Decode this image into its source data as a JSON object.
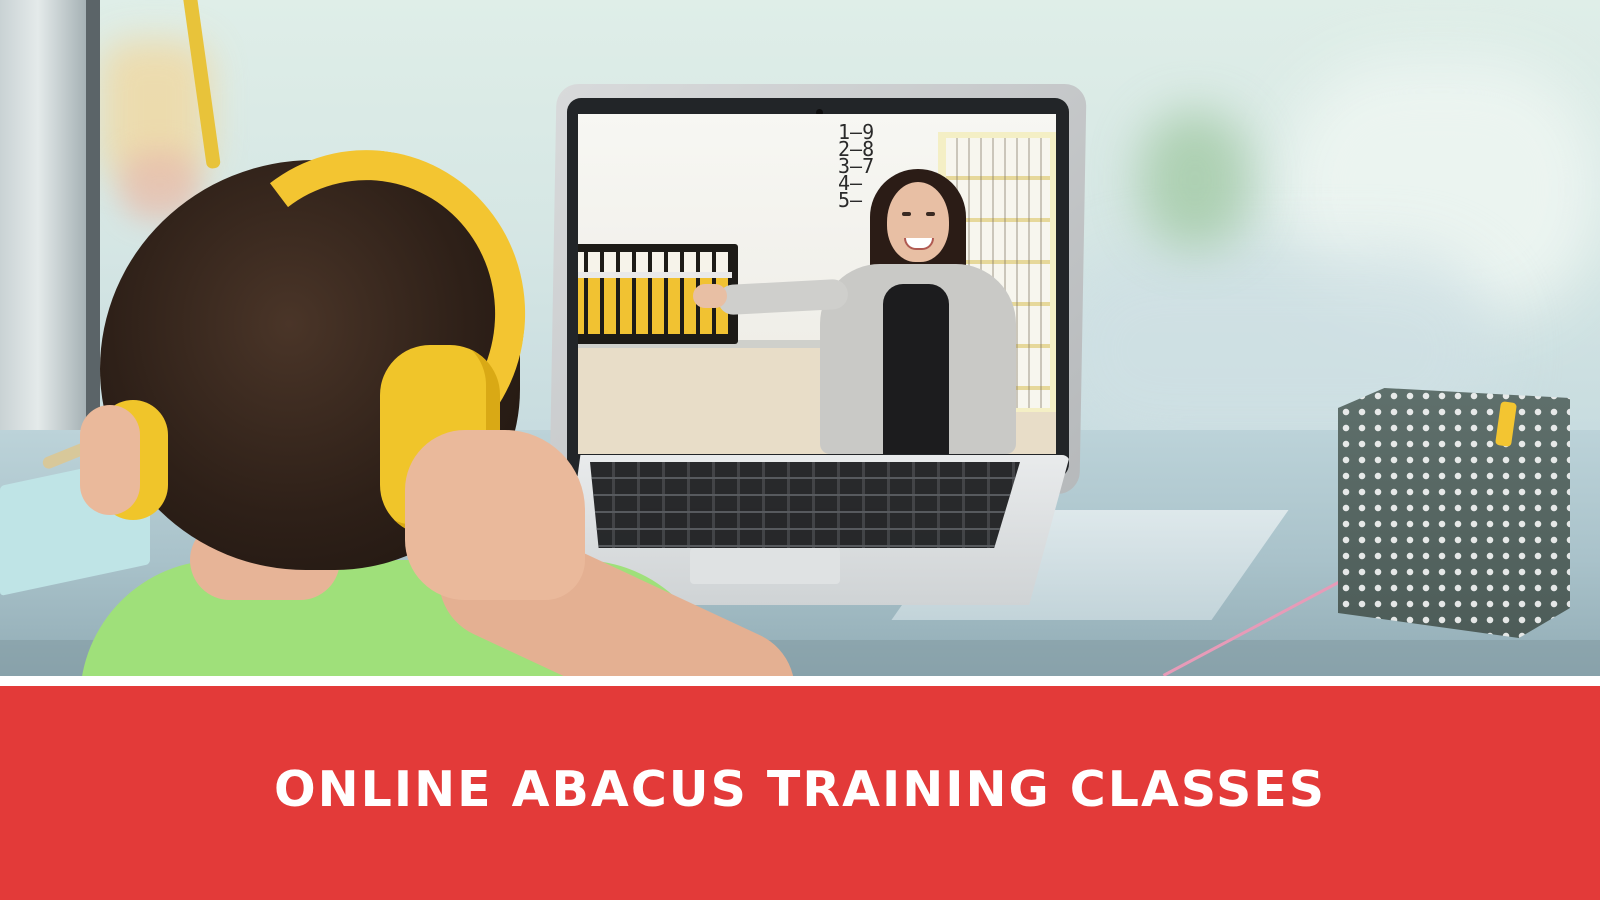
{
  "banner": {
    "title": "ONLINE ABACUS TRAINING CLASSES",
    "background_color": "#e33a39",
    "text_color": "#ffffff"
  },
  "photo": {
    "whiteboard_numbers": [
      "1—9",
      "2—8",
      "3—7",
      "4—",
      "5—"
    ],
    "accent_color": "#f3c531"
  }
}
